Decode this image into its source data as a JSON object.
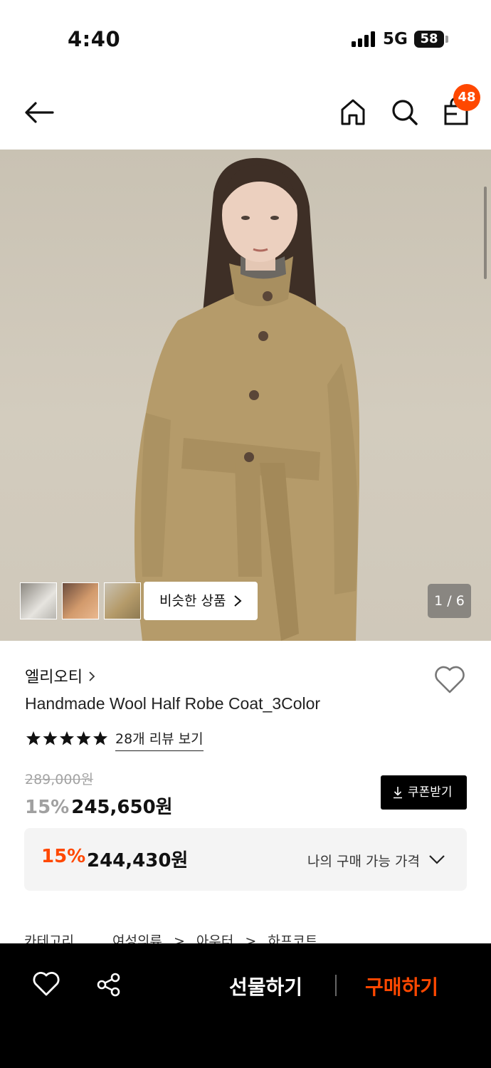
{
  "status_bar": {
    "time": "4:40",
    "network": "5G",
    "battery": "58"
  },
  "nav": {
    "cart_count": "48"
  },
  "gallery": {
    "similar_label": "비슷한 상품",
    "counter": "1 / 6"
  },
  "product": {
    "brand": "엘리오티",
    "title": "Handmade Wool Half Robe Coat_3Color",
    "rating_stars": 5,
    "review_link": "28개 리뷰 보기",
    "original_price": "289,000원",
    "discount_rate": "15%",
    "discount_price": "245,650원",
    "coupon_label": "쿠폰받기",
    "best": {
      "rate": "15%",
      "price": "244,430원",
      "label": "나의 구매 가능 가격"
    },
    "category": {
      "label": "카테고리",
      "path": [
        "여성의류",
        "아우터",
        "하프코트"
      ]
    }
  },
  "bottom_bar": {
    "gift_label": "선물하기",
    "buy_label": "구매하기"
  },
  "colors": {
    "accent": "#ff4800",
    "coat": "#b59b6a",
    "background": "#ffffff",
    "bottom_bar": "#000000"
  }
}
